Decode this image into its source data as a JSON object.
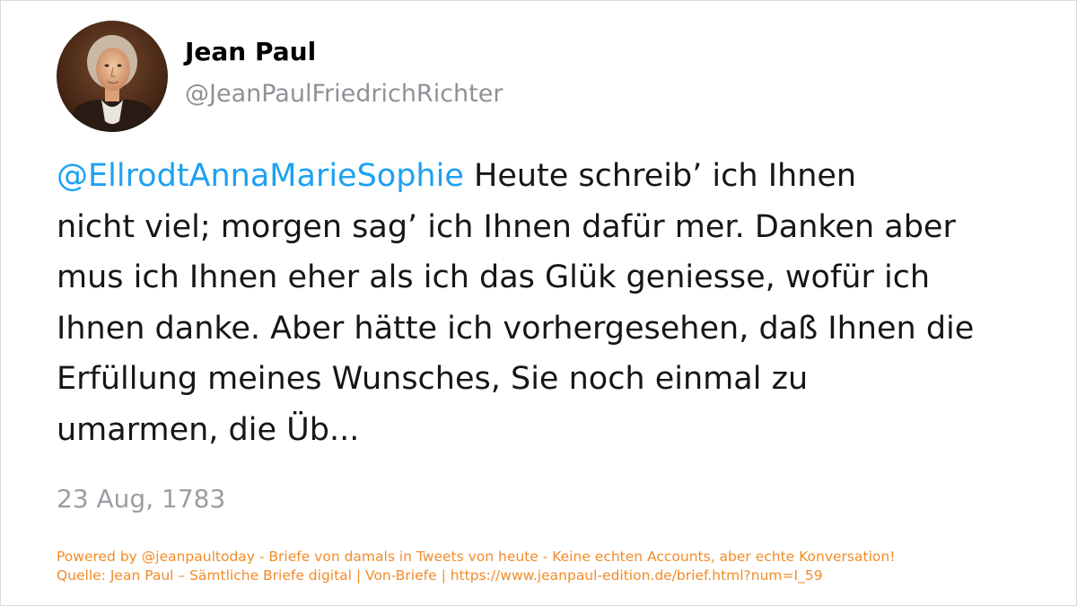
{
  "author": {
    "name": "Jean Paul",
    "handle": "@JeanPaulFriedrichRichter",
    "avatar_icon": "portrait-avatar-icon"
  },
  "tweet": {
    "mention": "@EllrodtAnnaMarieSophie",
    "text_lines": [
      " Heute schreib’ ich Ihnen",
      "nicht viel; morgen sag’ ich Ihnen dafür mer. Danken aber",
      "mus ich Ihnen eher als ich das Glük geniesse, wofür ich",
      "Ihnen danke. Aber hätte ich vorhergesehen, daß Ihnen die",
      "Erfüllung meines Wunsches, Sie noch einmal zu",
      "umarmen, die Üb..."
    ],
    "date": "23 Aug, 1783"
  },
  "footer": {
    "powered_by": "Powered by @jeanpaultoday - Briefe von damals in Tweets von heute - Keine echten Accounts, aber echte Konversation!",
    "source": "Quelle: Jean Paul – Sämtliche Briefe digital | Von-Briefe | https://www.jeanpaul-edition.de/brief.html?num=I_59"
  },
  "colors": {
    "mention": "#1da1f2",
    "text": "#14171a",
    "muted": "#8e9297",
    "footer": "#f28c28"
  }
}
